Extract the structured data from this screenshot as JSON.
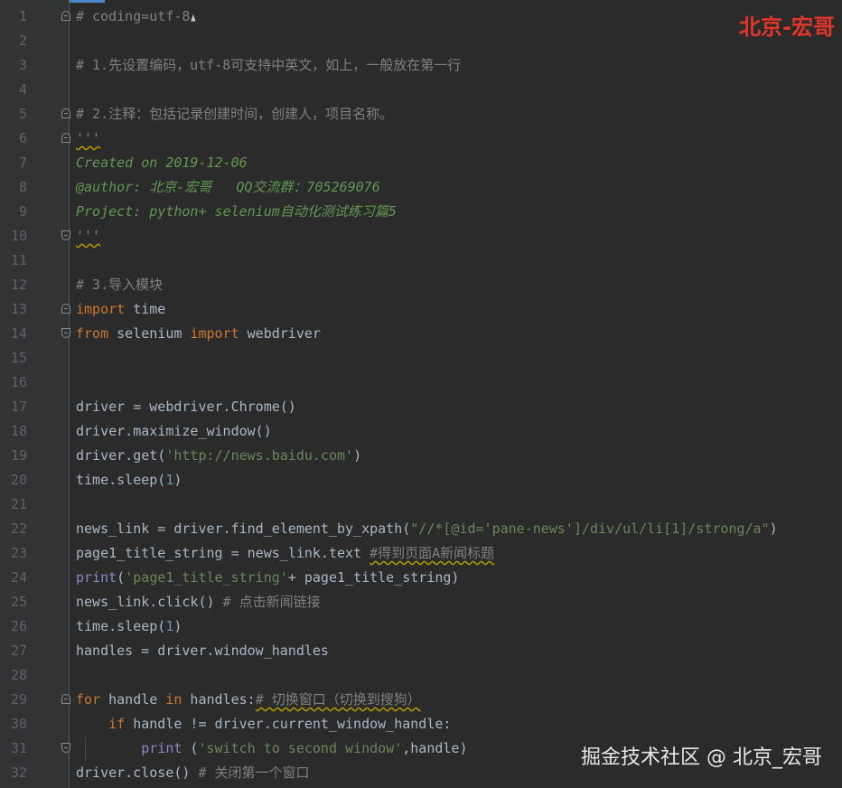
{
  "editor": {
    "line_numbers": [
      "1",
      "2",
      "3",
      "4",
      "5",
      "6",
      "7",
      "8",
      "9",
      "10",
      "11",
      "12",
      "13",
      "14",
      "15",
      "16",
      "17",
      "18",
      "19",
      "20",
      "21",
      "22",
      "23",
      "24",
      "25",
      "26",
      "27",
      "28",
      "29",
      "30",
      "31",
      "32"
    ],
    "lines": {
      "l1": "# coding=utf-8",
      "l3": "# 1.先设置编码，utf-8可支持中英文，如上，一般放在第一行",
      "l5": "# 2.注释：包括记录创建时间，创建人，项目名称。",
      "l6": "'''",
      "l7": "Created on 2019-12-06",
      "l8": "@author: 北京-宏哥   QQ交流群：705269076",
      "l9": "Project: python+ selenium自动化测试练习篇5",
      "l10": "'''",
      "l12": "# 3.导入模块",
      "l13_kw": "import",
      "l13_rest": " time",
      "l14_kw1": "from",
      "l14_mid": " selenium ",
      "l14_kw2": "import",
      "l14_rest": " webdriver",
      "l17": "driver = webdriver.Chrome()",
      "l18": "driver.maximize_window()",
      "l19_a": "driver.get(",
      "l19_str": "'http://news.baidu.com'",
      "l19_b": ")",
      "l20_a": "time.sleep(",
      "l20_num": "1",
      "l20_b": ")",
      "l22_a": "news_link = driver.find_element_by_xpath(",
      "l22_str": "\"//*[@id='pane-news']/div/ul/li[1]/strong/a\"",
      "l22_b": ")",
      "l23_a": "page1_title_string = news_link.text ",
      "l23_cmt": "#得到页面A新闻标题",
      "l24_builtin": "print",
      "l24_a": "(",
      "l24_str": "'page1_title_string'",
      "l24_b": "+ page1_title_string)",
      "l25_a": "news_link.click() ",
      "l25_cmt": "# 点击新闻链接",
      "l26_a": "time.sleep(",
      "l26_num": "1",
      "l26_b": ")",
      "l27": "handles = driver.window_handles",
      "l29_kw1": "for",
      "l29_a": " handle ",
      "l29_kw2": "in",
      "l29_b": " handles:",
      "l29_cmt": "# 切换窗口（切换到搜狗）",
      "l30_kw": "if",
      "l30_a": " handle != driver.current_window_handle:",
      "l31_builtin": "print",
      "l31_a": " (",
      "l31_str": "'switch to second window'",
      "l31_b": ",handle)",
      "l32_a": "driver.close() ",
      "l32_cmt": "# 关闭第一个窗口"
    }
  },
  "watermark": {
    "top": "北京-宏哥",
    "bottom": "掘金技术社区 @ 北京_宏哥"
  },
  "colors": {
    "background": "#2b2b2b",
    "keyword": "#cc7832",
    "string": "#6a8759",
    "docstring": "#629755",
    "comment": "#808080",
    "watermark_red": "#e3362a"
  }
}
